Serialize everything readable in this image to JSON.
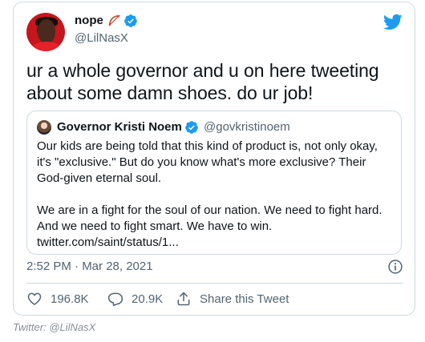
{
  "author": {
    "display_name": "nope",
    "name_emoji": "bow-and-arrow-icon",
    "handle": "@LilNasX",
    "verified": true
  },
  "tweet": {
    "text": "ur a whole governor and u on here tweeting about some damn shoes. do ur job!",
    "timestamp": "2:52 PM · Mar 28, 2021"
  },
  "quoted_tweet": {
    "display_name": "Governor Kristi Noem",
    "handle": "@govkristinoem",
    "paragraph_1": "Our kids are being told that this kind of product is, not only okay, it's \"exclusive.\" But do you know what's more exclusive? Their God-given eternal soul.",
    "paragraph_2": "We are in a fight for the soul of our nation. We need to fight hard. And we need to fight smart. We have to win.",
    "link": "twitter.com/saint/status/1..."
  },
  "actions": {
    "likes": "196.8K",
    "replies": "20.9K",
    "share_label": "Share this Tweet"
  },
  "caption": "Twitter: @LilNasX",
  "colors": {
    "brand_blue": "#1d9bf0",
    "muted_text": "#536471",
    "border": "#cfd9de"
  }
}
